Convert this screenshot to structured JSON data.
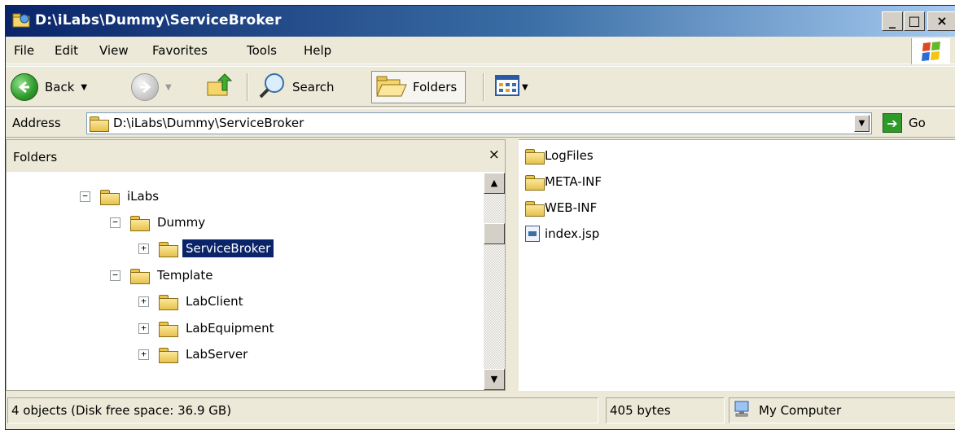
{
  "window": {
    "title": "D:\\iLabs\\Dummy\\ServiceBroker",
    "controls": {
      "minimize": "_",
      "maximize": "□",
      "close": "×"
    }
  },
  "menu": {
    "file": "File",
    "edit": "Edit",
    "view": "View",
    "favorites": "Favorites",
    "tools": "Tools",
    "help": "Help"
  },
  "toolbar": {
    "back_label": "Back",
    "search_label": "Search",
    "folders_label": "Folders"
  },
  "address": {
    "label": "Address",
    "value": "D:\\iLabs\\Dummy\\ServiceBroker",
    "go_label": "Go"
  },
  "folders_pane": {
    "title": "Folders",
    "close_glyph": "×",
    "tree": [
      {
        "label": "iLabs",
        "expander": "−",
        "selected": false
      },
      {
        "label": "Dummy",
        "expander": "−",
        "selected": false
      },
      {
        "label": "ServiceBroker",
        "expander": "+",
        "selected": true
      },
      {
        "label": "Template",
        "expander": "−",
        "selected": false
      },
      {
        "label": "LabClient",
        "expander": "+",
        "selected": false
      },
      {
        "label": "LabEquipment",
        "expander": "+",
        "selected": false
      },
      {
        "label": "LabServer",
        "expander": "+",
        "selected": false
      }
    ]
  },
  "files": [
    {
      "name": "LogFiles",
      "type": "folder"
    },
    {
      "name": "META-INF",
      "type": "folder"
    },
    {
      "name": "WEB-INF",
      "type": "folder"
    },
    {
      "name": "index.jsp",
      "type": "file"
    }
  ],
  "status": {
    "objects": "4 objects (Disk free space: 36.9 GB)",
    "size": "405 bytes",
    "zone": "My Computer"
  },
  "colors": {
    "title_bar": "#0a246a",
    "selection": "#0a246a",
    "chrome": "#ece9d8",
    "folder": "#e8c44f",
    "go_green": "#2e9a2a"
  },
  "icons": {
    "app": "folder-icon",
    "back": "back-arrow-icon",
    "forward": "forward-arrow-icon",
    "up": "up-folder-icon",
    "search": "magnifier-icon",
    "folders": "folders-icon",
    "views": "views-grid-icon",
    "go": "go-arrow-icon",
    "windows_flag": "windows-flag-icon",
    "computer": "computer-icon"
  }
}
